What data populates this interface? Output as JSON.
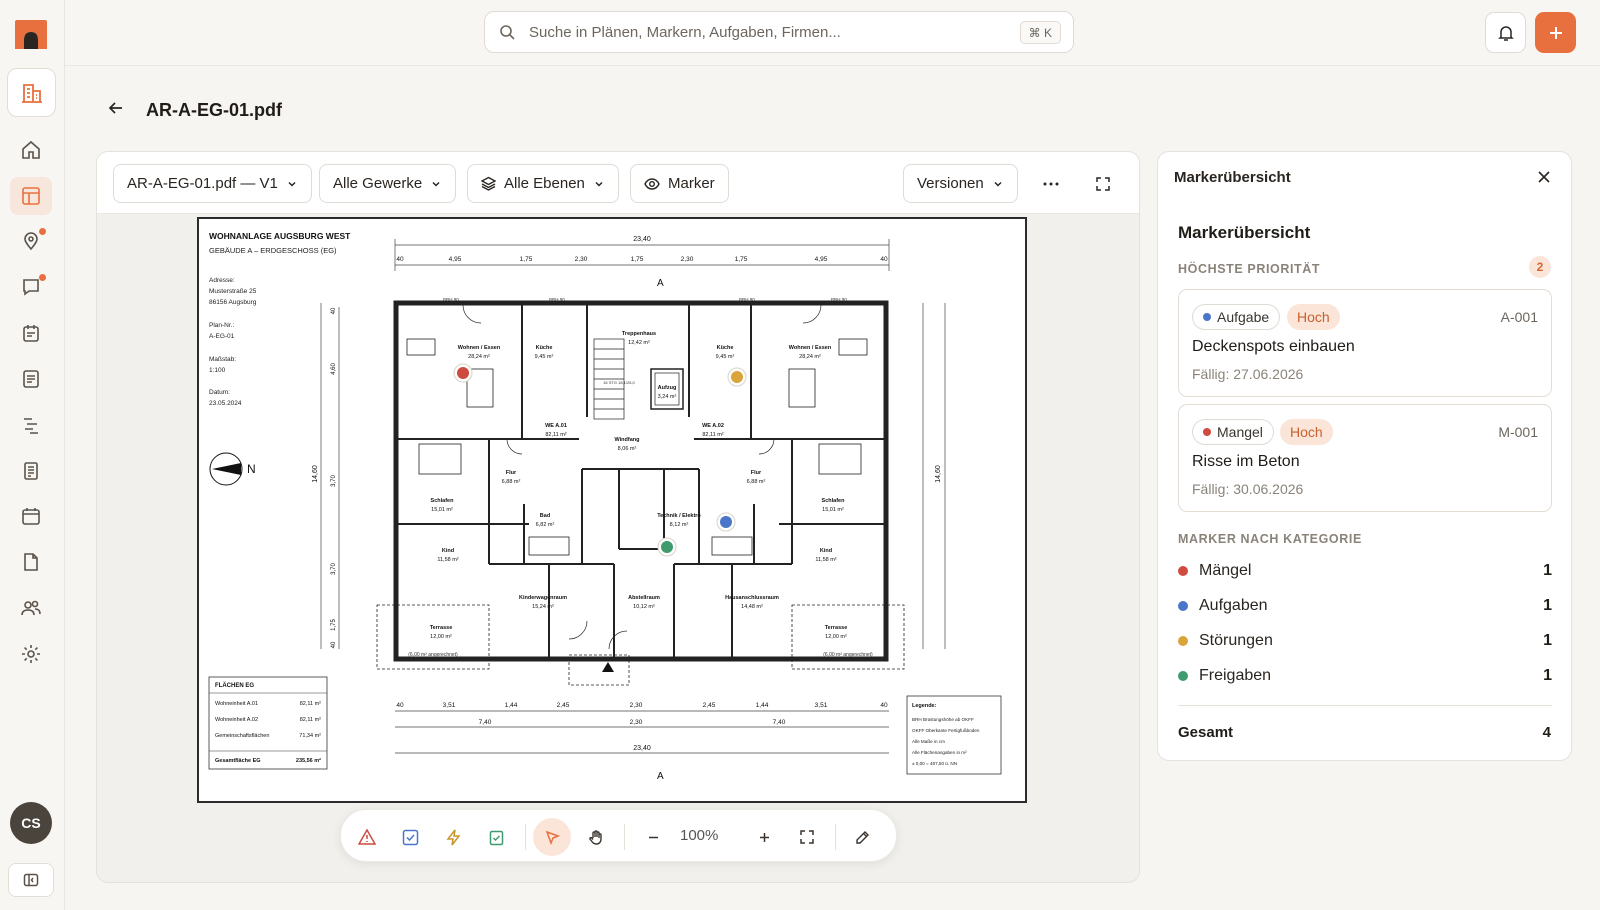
{
  "search": {
    "placeholder": "Suche in Plänen, Markern, Aufgaben, Firmen...",
    "shortcut": "⌘ K"
  },
  "user": {
    "initials": "CS"
  },
  "page": {
    "title": "AR-A-EG-01.pdf"
  },
  "toolbar": {
    "file_version": "AR-A-EG-01.pdf — V1",
    "trades": "Alle Gewerke",
    "layers": "Alle Ebenen",
    "marker": "Marker",
    "versions": "Versionen"
  },
  "zoom": {
    "level": "100%"
  },
  "plan": {
    "project": "WOHNANLAGE AUGSBURG WEST",
    "building": "GEBÄUDE A – ERDGESCHOSS (EG)",
    "address_label": "Adresse:",
    "address_line1": "Musterstraße 25",
    "address_line2": "86156 Augsburg",
    "plan_no_label": "Plan-Nr.:",
    "plan_no": "A-EG-01",
    "scale_label": "Maßstab:",
    "scale": "1:100",
    "date_label": "Datum:",
    "date": "23.05.2024",
    "north": "N",
    "section_mark": "A",
    "dim_total": "23,40",
    "dim_top": [
      "40",
      "4,95",
      "1,75",
      "2,30",
      "1,75",
      "2,30",
      "1,75",
      "4,95",
      "40"
    ],
    "dim_bottom": [
      "40",
      "3,51",
      "1,44",
      "2,45",
      "2,30",
      "2,45",
      "1,44",
      "3,51",
      "40"
    ],
    "dim_bottom2": [
      "7,40",
      "2,30",
      "7,40"
    ],
    "dim_left": [
      "40",
      "4,60",
      "3,70",
      "3,70",
      "1,75",
      "40"
    ],
    "dim_height": "14,60",
    "rooms": [
      {
        "name": "Wohnen / Essen",
        "area": "28,24 m²"
      },
      {
        "name": "Küche",
        "area": "9,45 m²"
      },
      {
        "name": "Treppenhaus",
        "area": "12,42 m²"
      },
      {
        "name": "Aufzug",
        "area": "3,24 m²"
      },
      {
        "name": "Küche",
        "area": "9,45 m²"
      },
      {
        "name": "Wohnen / Essen",
        "area": "28,24 m²"
      },
      {
        "name": "WE A.01",
        "area": "82,11 m²"
      },
      {
        "name": "Windfang",
        "area": "8,06 m²"
      },
      {
        "name": "WE A.02",
        "area": "82,11 m²"
      },
      {
        "name": "Schlafen",
        "area": "15,01 m²"
      },
      {
        "name": "Flur",
        "area": "6,88 m²"
      },
      {
        "name": "Bad",
        "area": "6,82 m²"
      },
      {
        "name": "Technik / Elektro",
        "area": "8,12 m²"
      },
      {
        "name": "Flur",
        "area": "6,88 m²"
      },
      {
        "name": "Schlafen",
        "area": "15,01 m²"
      },
      {
        "name": "Kind",
        "area": "11,58 m²"
      },
      {
        "name": "Kinderwagenraum",
        "area": "15,24 m²"
      },
      {
        "name": "Abstellraum",
        "area": "10,12 m²"
      },
      {
        "name": "Hausanschlussraum",
        "area": "14,48 m²"
      },
      {
        "name": "Kind",
        "area": "11,58 m²"
      },
      {
        "name": "Terrasse",
        "area": "12,00 m²"
      },
      {
        "name": "Terrasse",
        "area": "12,00 m²"
      }
    ],
    "terrace_note": "(6,00 m² angerechnet)",
    "stairs_note": "16 STG 18,1/26,0",
    "brh_label": "BRH 90",
    "areas_table": {
      "title": "FLÄCHEN EG",
      "rows": [
        {
          "label": "Wohneinheit A.01",
          "value": "82,11 m²"
        },
        {
          "label": "Wohneinheit A.02",
          "value": "82,11 m²"
        },
        {
          "label": "Gemeinschaftsflächen",
          "value": "71,34 m²"
        }
      ],
      "total_label": "Gesamtfläche EG",
      "total_value": "235,56 m²"
    },
    "legend": {
      "title": "Legende:",
      "lines": [
        "BRH   Brüstungshöhe ab OKFF",
        "OKFF  Oberkante Fertigfußboden",
        "Alle Maße in cm",
        "Alle Flächenangaben in m²",
        "± 0,00 = 487,50 ü. NN"
      ]
    }
  },
  "panel": {
    "header": "Markerübersicht",
    "title": "Markerübersicht",
    "priority_label": "HÖCHSTE PRIORITÄT",
    "priority_count": "2",
    "cards": [
      {
        "type": "Aufgabe",
        "type_color": "#4a76c9",
        "priority": "Hoch",
        "id": "A-001",
        "title": "Deckenspots einbauen",
        "due": "Fällig: 27.06.2026"
      },
      {
        "type": "Mangel",
        "type_color": "#cf4a3f",
        "priority": "Hoch",
        "id": "M-001",
        "title": "Risse im Beton",
        "due": "Fällig: 30.06.2026"
      }
    ],
    "category_label": "MARKER NACH KATEGORIE",
    "categories": [
      {
        "label": "Mängel",
        "count": "1",
        "color": "#cf4a3f"
      },
      {
        "label": "Aufgaben",
        "count": "1",
        "color": "#4a76c9"
      },
      {
        "label": "Störungen",
        "count": "1",
        "color": "#d9a53a"
      },
      {
        "label": "Freigaben",
        "count": "1",
        "color": "#3f9a6e"
      }
    ],
    "total_label": "Gesamt",
    "total_count": "4"
  },
  "colors": {
    "accent": "#e8703f"
  }
}
